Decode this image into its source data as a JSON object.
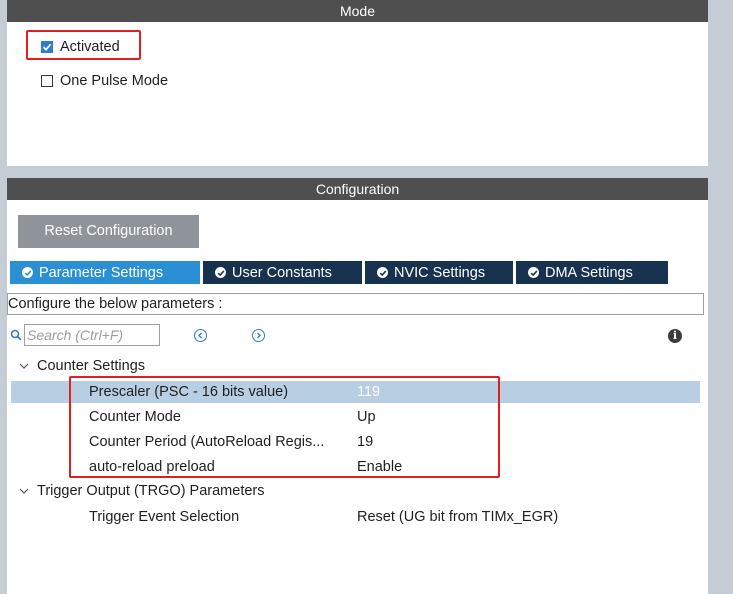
{
  "mode": {
    "header": "Mode",
    "activated_label": "Activated",
    "activated_checked": true,
    "one_pulse_label": "One Pulse Mode",
    "one_pulse_checked": false
  },
  "configuration": {
    "header": "Configuration",
    "reset_button": "Reset Configuration",
    "tabs": [
      {
        "label": "Parameter Settings",
        "active": true
      },
      {
        "label": "User Constants",
        "active": false
      },
      {
        "label": "NVIC Settings",
        "active": false
      },
      {
        "label": "DMA Settings",
        "active": false
      }
    ],
    "info_text": "Configure the below parameters :",
    "search_placeholder": "Search (Ctrl+F)",
    "groups": [
      {
        "label": "Counter Settings",
        "params": [
          {
            "name": "Prescaler (PSC - 16 bits value)",
            "value": "119"
          },
          {
            "name": "Counter Mode",
            "value": "Up"
          },
          {
            "name": "Counter Period (AutoReload Regis...",
            "value": "19"
          },
          {
            "name": "auto-reload preload",
            "value": "Enable"
          }
        ]
      },
      {
        "label": "Trigger Output (TRGO) Parameters",
        "params": [
          {
            "name": "Trigger Event Selection",
            "value": "Reset (UG bit from TIMx_EGR)"
          }
        ]
      }
    ]
  },
  "colors": {
    "active_tab": "#2a8fd3",
    "inactive_tab": "#16324f",
    "header_bar": "#4f4f4f",
    "highlight": "#e02020",
    "selected_row": "#b8cee2"
  }
}
